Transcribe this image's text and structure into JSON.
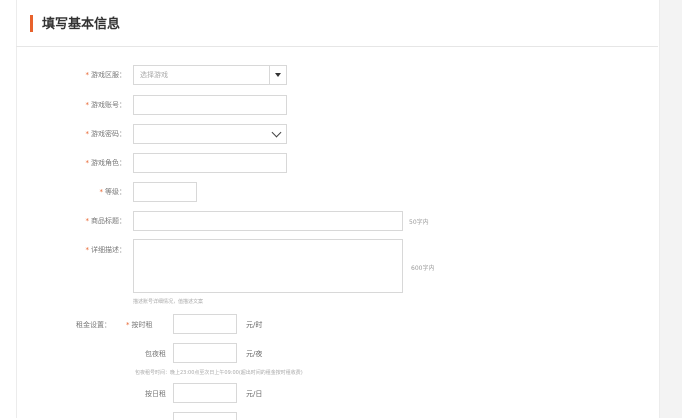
{
  "header": {
    "title": "填写基本信息"
  },
  "form": {
    "server": {
      "label": "游戏区服：",
      "placeholder": "选择游戏"
    },
    "account": {
      "label": "游戏账号："
    },
    "password": {
      "label": "游戏密码："
    },
    "role": {
      "label": "游戏角色："
    },
    "level": {
      "label": "等级："
    },
    "product_title": {
      "label": "商品标题：",
      "limit": "50字内"
    },
    "description": {
      "label": "详细描述：",
      "limit": "600字内",
      "hint": "描述账号详细情况，值描述文案"
    },
    "rent_settings": {
      "label": "租金设置：",
      "hourly": {
        "label": "按时租",
        "unit": "元/时"
      },
      "overnight": {
        "label": "包夜租",
        "unit": "元/夜",
        "hint": "包夜租号时间：晚上23:00点至次日上午09:00(超出时间的租金按时租收费)"
      },
      "daily": {
        "label": "按日租",
        "unit": "元/日"
      }
    }
  },
  "colors": {
    "accent": "#e8622c"
  }
}
